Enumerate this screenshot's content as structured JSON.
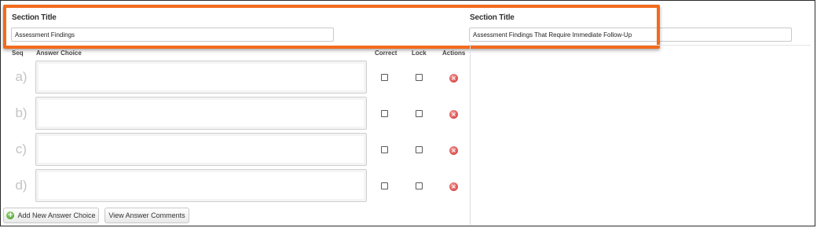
{
  "sections": [
    {
      "label": "Section Title",
      "value": "Assessment Findings",
      "placeholder": ""
    },
    {
      "label": "Section Title",
      "value": "Assessment Findings That Require Immediate Follow-Up",
      "placeholder": ""
    }
  ],
  "table": {
    "headers": {
      "seq": "Seq",
      "answer": "Answer Choice",
      "correct": "Correct",
      "lock": "Lock",
      "actions": "Actions"
    },
    "rows": [
      {
        "seq": "a)",
        "answer": "",
        "correct": false,
        "lock": false
      },
      {
        "seq": "b)",
        "answer": "",
        "correct": false,
        "lock": false
      },
      {
        "seq": "c)",
        "answer": "",
        "correct": false,
        "lock": false
      },
      {
        "seq": "d)",
        "answer": "",
        "correct": false,
        "lock": false
      }
    ]
  },
  "buttons": {
    "add": "Add New Answer Choice",
    "comments": "View Answer Comments"
  },
  "icons": {
    "add": "plus-circle-icon",
    "delete": "delete-circle-icon"
  },
  "colors": {
    "highlight": "#f26b1d",
    "delete": "#e05a5a",
    "add": "#5fb13f"
  }
}
